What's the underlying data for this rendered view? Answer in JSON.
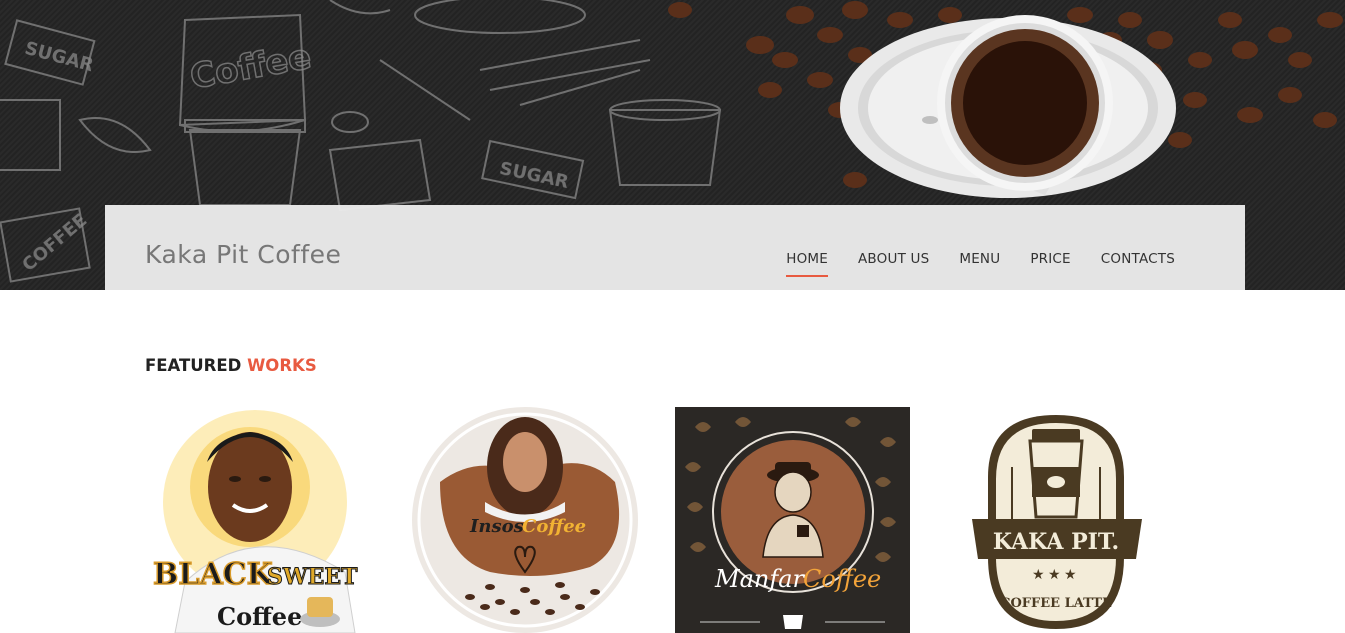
{
  "brand": "Kaka Pit Coffee",
  "nav": {
    "items": [
      {
        "label": "HOME",
        "active": true
      },
      {
        "label": "ABOUT US",
        "active": false
      },
      {
        "label": "MENU",
        "active": false
      },
      {
        "label": "PRICE",
        "active": false
      },
      {
        "label": "CONTACTS",
        "active": false
      }
    ],
    "accent_color": "#e85a40"
  },
  "hero": {
    "doodle_labels": [
      "Coffee",
      "SUGAR",
      "SUGAR",
      "COFFEE"
    ]
  },
  "featured": {
    "title_part1": "FEATURED ",
    "title_part2": "WORKS",
    "works": [
      {
        "line1": "BLACK",
        "line2": "SWEET",
        "line3": "Coffee"
      },
      {
        "line1": "Insos",
        "line2": "Coffee"
      },
      {
        "line1": "Manfar",
        "line2": "Coffee"
      },
      {
        "line1": "KAKA PIT.",
        "line2": "COFFEE LATTE"
      }
    ]
  }
}
